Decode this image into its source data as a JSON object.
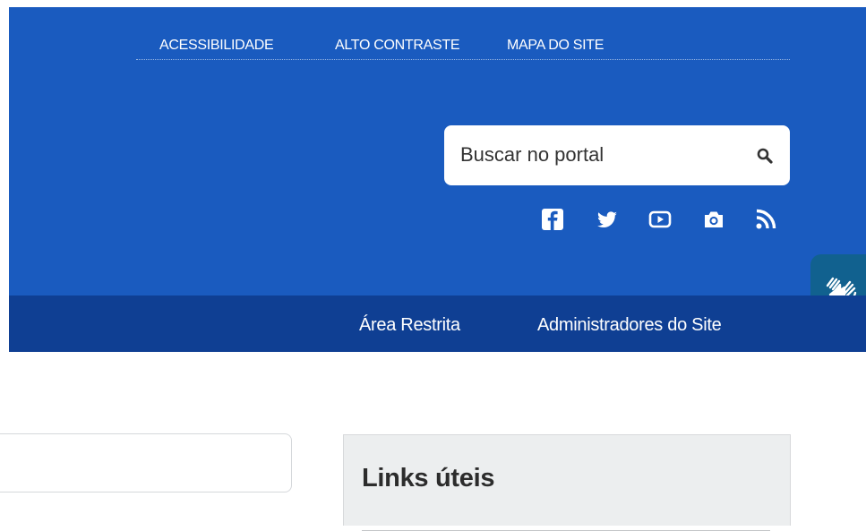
{
  "top_nav": {
    "items": [
      {
        "label": "ACESSIBILIDADE"
      },
      {
        "label": "ALTO CONTRASTE"
      },
      {
        "label": "MAPA DO SITE"
      }
    ]
  },
  "search": {
    "placeholder": "Buscar no portal",
    "icon": "search-icon"
  },
  "social": {
    "icons": [
      "facebook-icon",
      "twitter-icon",
      "youtube-icon",
      "camera-icon",
      "rss-icon"
    ]
  },
  "nav": {
    "items": [
      {
        "label": "Área Restrita"
      },
      {
        "label": "Administradores do Site"
      }
    ]
  },
  "vlibras": {
    "icon": "hands-icon"
  },
  "sidebar": {
    "title": "Links úteis"
  },
  "colors": {
    "header_bg": "#1a5bbf",
    "navbar_bg": "#0f3f93",
    "vlibras_bg": "#11618f"
  }
}
